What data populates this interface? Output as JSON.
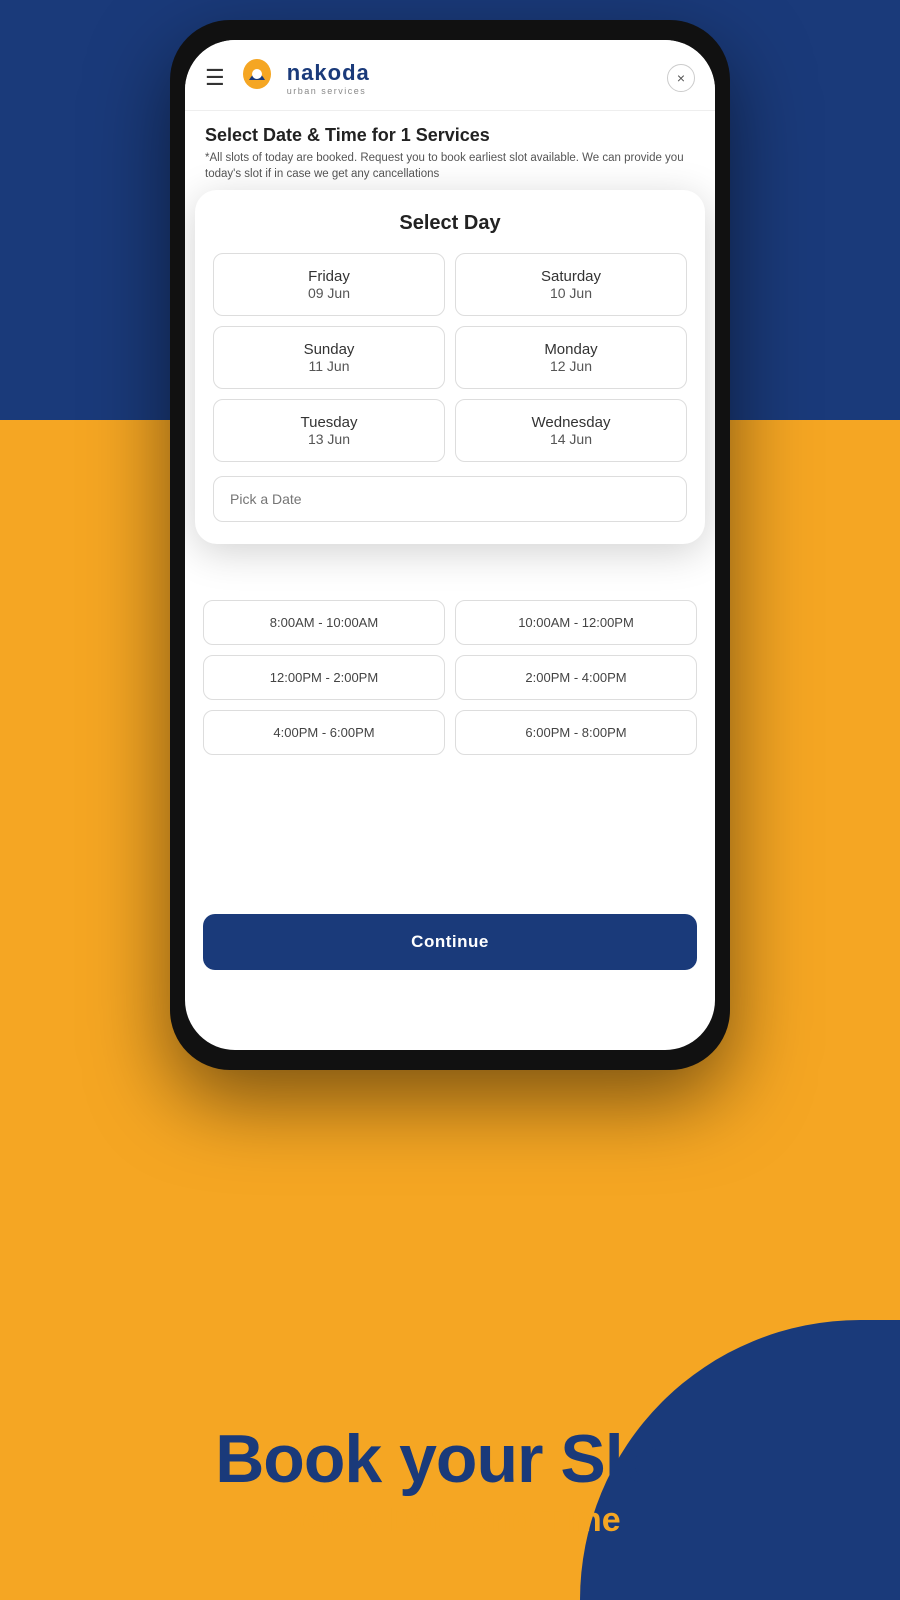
{
  "background": {
    "top_color": "#1A3A7A",
    "main_color": "#F5A623"
  },
  "header": {
    "menu_icon": "☰",
    "logo_name": "nakoda",
    "logo_tagline": "urban services",
    "close_icon": "×"
  },
  "select_datetime": {
    "title": "Select Date & Time for 1 Services",
    "note": "*All slots of today are booked. Request you to book earliest slot available. We can provide you today's slot if in case we get any cancellations"
  },
  "select_day_modal": {
    "title": "Select Day",
    "days": [
      {
        "name": "Friday",
        "date": "09 Jun"
      },
      {
        "name": "Saturday",
        "date": "10 Jun"
      },
      {
        "name": "Sunday",
        "date": "11 Jun"
      },
      {
        "name": "Monday",
        "date": "12 Jun"
      },
      {
        "name": "Tuesday",
        "date": "13 Jun"
      },
      {
        "name": "Wednesday",
        "date": "14 Jun"
      }
    ],
    "pick_date_placeholder": "Pick a Date"
  },
  "time_slots": [
    {
      "label": "8:00AM - 10:00AM"
    },
    {
      "label": "10:00AM - 12:00PM"
    },
    {
      "label": "12:00PM - 2:00PM"
    },
    {
      "label": "2:00PM - 4:00PM"
    },
    {
      "label": "4:00PM - 6:00PM"
    },
    {
      "label": "6:00PM - 8:00PM"
    }
  ],
  "continue_button": {
    "label": "Continue"
  },
  "promo": {
    "title": "Book your Slot",
    "subtitle": "Select Date and Time"
  }
}
